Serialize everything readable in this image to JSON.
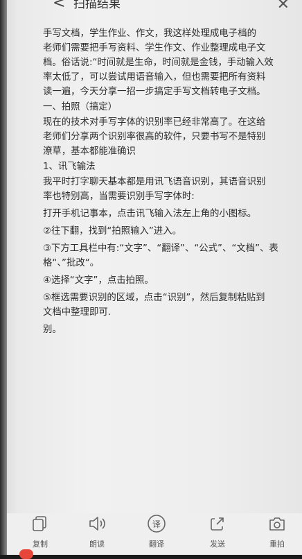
{
  "header": {
    "title": "扫描结果",
    "back": "<",
    "close": "✕"
  },
  "content": {
    "paragraphs": [
      "手写文档，学生作业、作文，我这样处理成电子档的\n老师们需要把手写资料、学生作文、作业整理成电子文\n档。俗话说:“时间就是生命，时间就是金钱，手动输入效\n率太低了，可以尝试用语音输入，但也需要把所有资料\n读一遍，今天分享一招一步搞定手写文档转电子文档。",
      "一、拍照（搞定）",
      "现在的技术对手写字体的识别率已经非常高了。在这给\n老师们分享两个识别率很高的软件，只要书写不是特别\n潦草，基本都能准确识",
      "1、讯飞输法",
      "我平时打字聊天基本都是用讯飞语音识别，其语音识别\n率也特别高，当需要识别手写字体时:",
      "打开手机记事本，点击讯飞输入法左上角的小图标。",
      "②往下翻，找到“拍照输入”进入。",
      "③下方工具栏中有:“文字”、“翻译”、“公式”、“文档”、表\n格“、”批改“。",
      "④选择“文字”，点击拍照。",
      "⑤框选需要识别的区域，点击“识别”，然后复制粘贴到\n文档中整理即可.",
      "别。"
    ]
  },
  "toolbar": {
    "items": [
      {
        "label": "复制",
        "icon": "copy-icon"
      },
      {
        "label": "朗读",
        "icon": "speaker-icon"
      },
      {
        "label": "翻译",
        "icon": "translate-icon",
        "glyph": "译"
      },
      {
        "label": "发送",
        "icon": "share-icon"
      },
      {
        "label": "重拍",
        "icon": "camera-icon"
      }
    ]
  }
}
